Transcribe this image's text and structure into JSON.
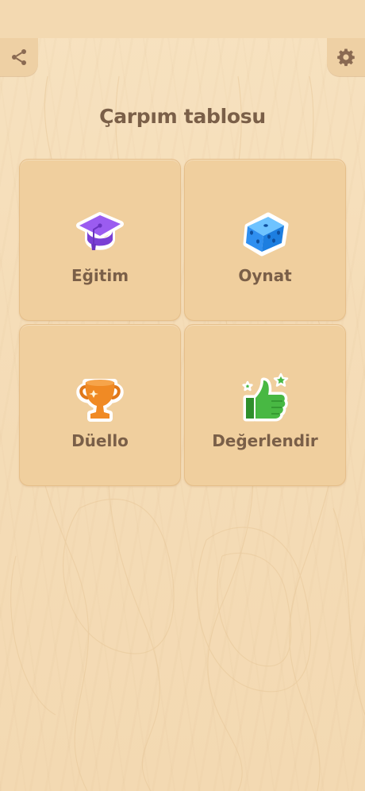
{
  "header": {
    "title": "Çarpım tablosu",
    "share_icon": "share-icon",
    "settings_icon": "gear-icon"
  },
  "menu": {
    "items": [
      {
        "label": "Eğitim",
        "icon": "graduation-cap-icon",
        "color": "#8b4ce6"
      },
      {
        "label": "Oynat",
        "icon": "dice-icon",
        "color": "#2f8ff0"
      },
      {
        "label": "Düello",
        "icon": "trophy-icon",
        "color": "#f08a24"
      },
      {
        "label": "Değerlendir",
        "icon": "thumbs-up-icon",
        "color": "#3fae3b"
      }
    ]
  },
  "colors": {
    "background": "#f5ddb8",
    "tile": "#f0cf9e",
    "text": "#7a5f48"
  }
}
